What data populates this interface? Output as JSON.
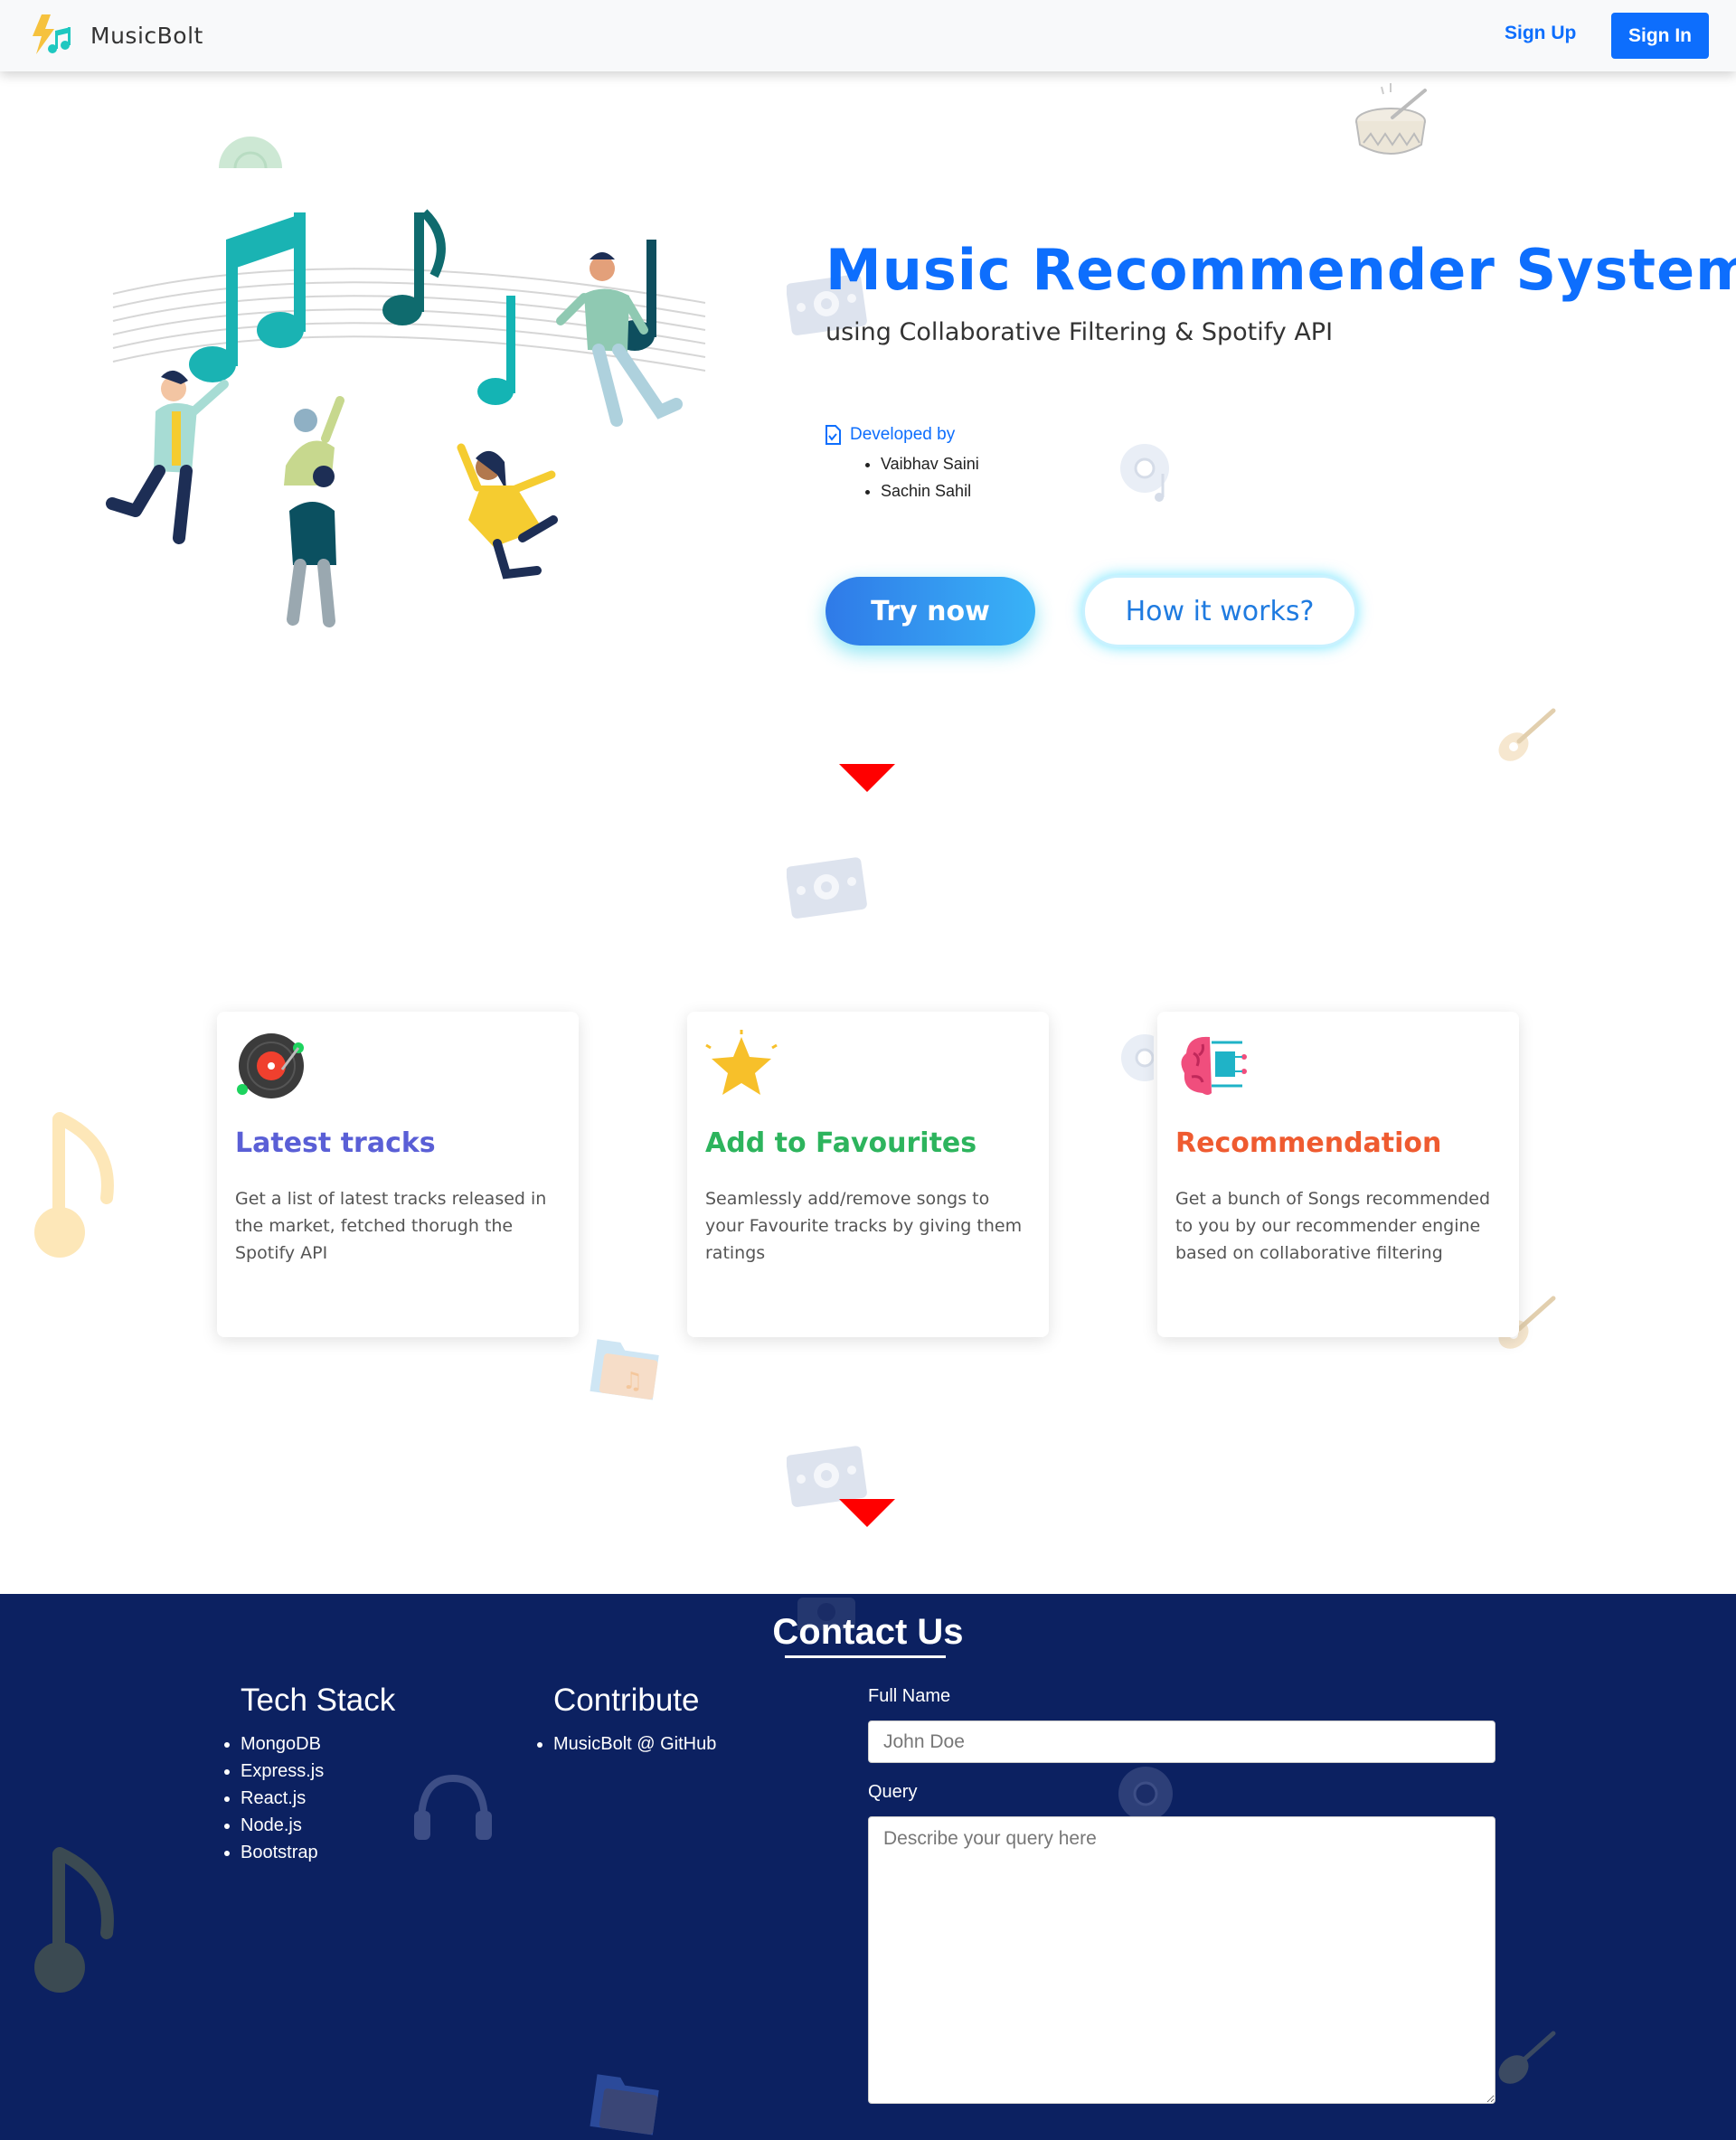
{
  "navbar": {
    "brand": "MusicBolt",
    "signup_label": "Sign Up",
    "signin_label": "Sign In"
  },
  "hero": {
    "title": "Music Recommender System",
    "subtitle": "using Collaborative Filtering & Spotify API",
    "developed_by_label": "Developed by",
    "developers": [
      "Vaibhav Saini",
      "Sachin Sahil"
    ],
    "try_button": "Try now",
    "how_button": "How it works?"
  },
  "features": [
    {
      "title": "Latest tracks",
      "text": "Get a list of latest tracks released in the market, fetched thorugh the Spotify API",
      "icon": "vinyl-record-icon",
      "color": "#5a5fd6"
    },
    {
      "title": "Add to Favourites",
      "text": "Seamlessly add/remove songs to your Favourite tracks by giving them ratings",
      "icon": "star-icon",
      "color": "#2db45d"
    },
    {
      "title": "Recommendation",
      "text": "Get a bunch of Songs recommended to you by our recommender engine based on collaborative filtering",
      "icon": "brain-circuit-icon",
      "color": "#ef5b30"
    }
  ],
  "footer": {
    "contact_title": "Contact Us",
    "tech_stack_title": "Tech Stack",
    "tech_stack": [
      "MongoDB",
      "Express.js",
      "React.js",
      "Node.js",
      "Bootstrap"
    ],
    "contribute_title": "Contribute",
    "contribute_links": [
      "MusicBolt @ GitHub"
    ],
    "full_name_label": "Full Name",
    "full_name_placeholder": "John Doe",
    "query_label": "Query",
    "query_placeholder": "Describe your query here"
  },
  "colors": {
    "primary": "#0d6efd",
    "footer_bg": "#0c2161",
    "arrow": "#ff0000"
  }
}
